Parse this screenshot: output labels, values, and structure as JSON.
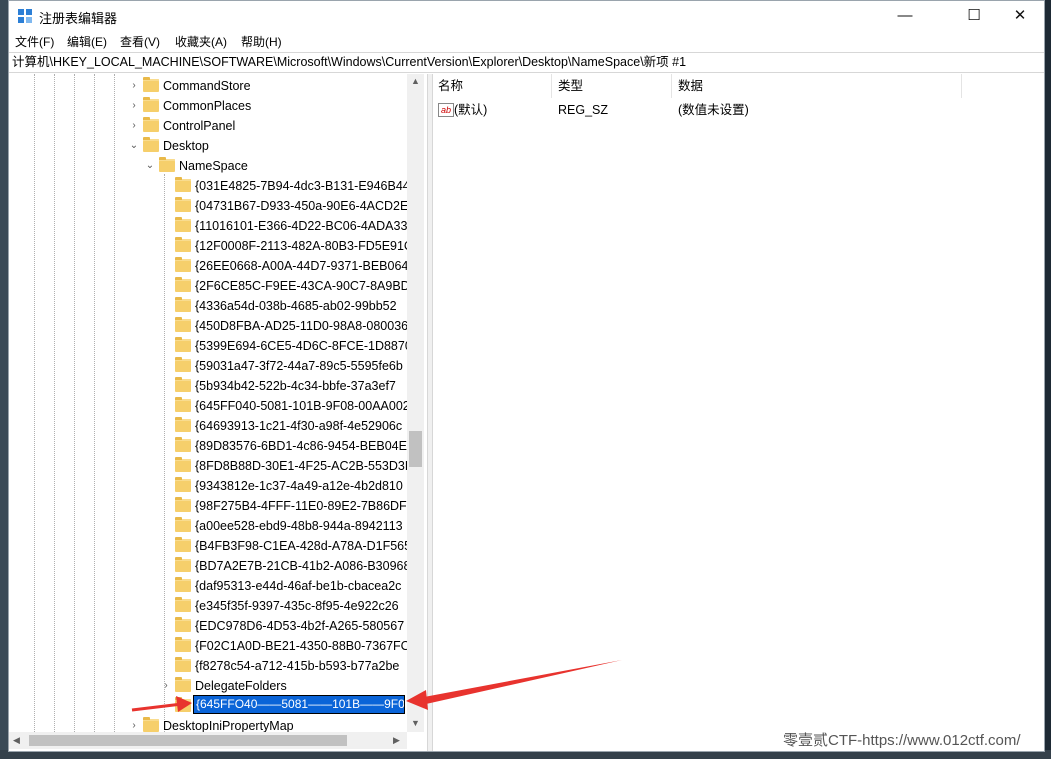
{
  "window": {
    "title": "注册表编辑器",
    "minimize": "—",
    "maximize": "☐",
    "close": "✕"
  },
  "menu": [
    "文件(F)",
    "编辑(E)",
    "查看(V)",
    "收藏夹(A)",
    "帮助(H)"
  ],
  "address": "计算机\\HKEY_LOCAL_MACHINE\\SOFTWARE\\Microsoft\\Windows\\CurrentVersion\\Explorer\\Desktop\\NameSpace\\新项 #1",
  "tree": {
    "top_items": [
      {
        "label": "CommandStore",
        "chevron": "›"
      },
      {
        "label": "CommonPlaces",
        "chevron": "›"
      },
      {
        "label": "ControlPanel",
        "chevron": "›"
      },
      {
        "label": "Desktop",
        "chevron": "⌄"
      }
    ],
    "namespace": {
      "label": "NameSpace",
      "chevron": "⌄"
    },
    "guid_items": [
      "{031E4825-7B94-4dc3-B131-E946B44",
      "{04731B67-D933-450a-90E6-4ACD2E",
      "{11016101-E366-4D22-BC06-4ADA33",
      "{12F0008F-2113-482A-80B3-FD5E91C",
      "{26EE0668-A00A-44D7-9371-BEB064",
      "{2F6CE85C-F9EE-43CA-90C7-8A9BD5",
      "{4336a54d-038b-4685-ab02-99bb52",
      "{450D8FBA-AD25-11D0-98A8-080036",
      "{5399E694-6CE5-4D6C-8FCE-1D8870",
      "{59031a47-3f72-44a7-89c5-5595fe6b",
      "{5b934b42-522b-4c34-bbfe-37a3ef7",
      "{645FF040-5081-101B-9F08-00AA002",
      "{64693913-1c21-4f30-a98f-4e52906c",
      "{89D83576-6BD1-4c86-9454-BEB04E",
      "{8FD8B88D-30E1-4F25-AC2B-553D3D",
      "{9343812e-1c37-4a49-a12e-4b2d810",
      "{98F275B4-4FFF-11E0-89E2-7B86DFD",
      "{a00ee528-ebd9-48b8-944a-8942113",
      "{B4FB3F98-C1EA-428d-A78A-D1F565",
      "{BD7A2E7B-21CB-41b2-A086-B30968",
      "{daf95313-e44d-46af-be1b-cbacea2c",
      "{e345f35f-9397-435c-8f95-4e922c26",
      "{EDC978D6-4D53-4b2f-A265-580567",
      "{F02C1A0D-BE21-4350-88B0-7367FC",
      "{f8278c54-a712-415b-b593-b77a2be"
    ],
    "delegate": {
      "label": "DelegateFolders",
      "chevron": "›"
    },
    "rename_value": "{645FFO40——5081——101B——9F0",
    "bottom_item": {
      "label": "DesktopIniPropertyMap",
      "chevron": "›"
    }
  },
  "list": {
    "headers": [
      "名称",
      "类型",
      "数据"
    ],
    "rows": [
      {
        "icon": "ab-string-icon",
        "name": "(默认)",
        "type": "REG_SZ",
        "data": "(数值未设置)"
      }
    ]
  },
  "watermark": "零壹贰CTF-https://www.012ctf.com/",
  "colors": {
    "selection": "#0a64d8",
    "folder": "#f6cf6b",
    "arrow": "#e8332e"
  }
}
